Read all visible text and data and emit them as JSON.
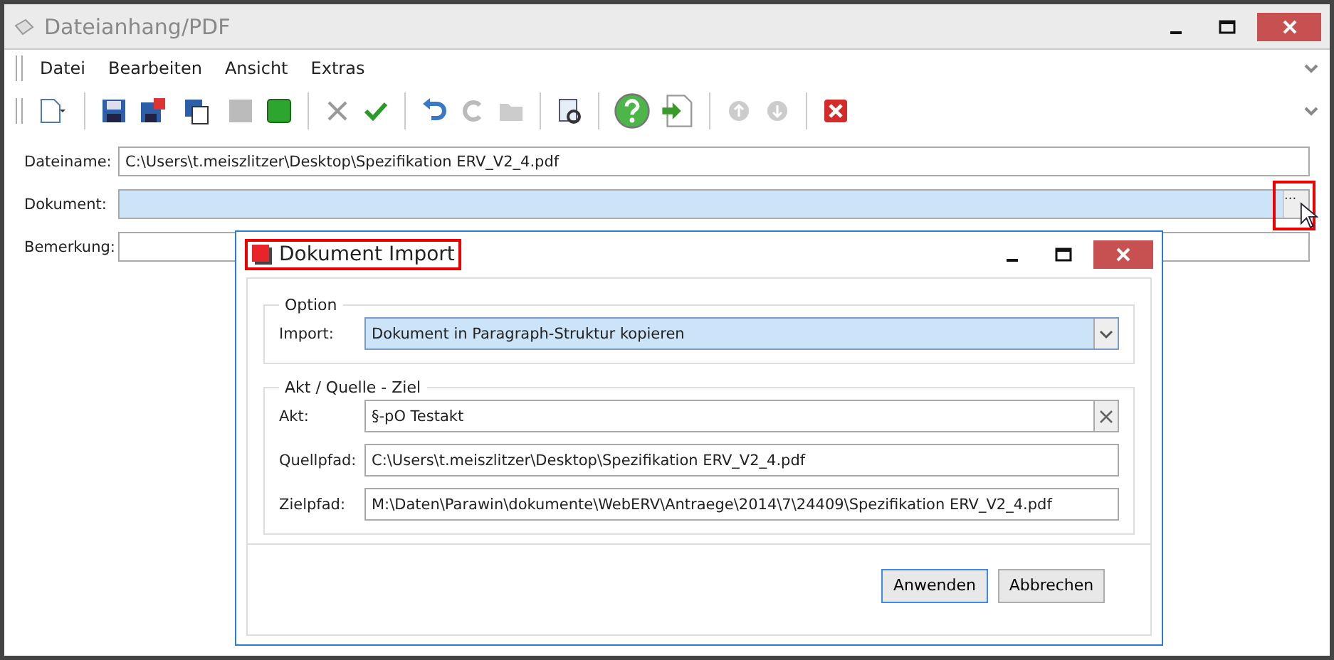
{
  "window": {
    "title": "Dateianhang/PDF"
  },
  "menu": [
    {
      "label": "Datei"
    },
    {
      "label": "Bearbeiten"
    },
    {
      "label": "Ansicht"
    },
    {
      "label": "Extras"
    }
  ],
  "form": [
    {
      "label": "Dateiname:",
      "value": "C:\\Users\\t.meiszlitzer\\Desktop\\Spezifikation ERV_V2_4.pdf",
      "selected": false
    },
    {
      "label": "Dokument:",
      "selected": true,
      "browse": "...",
      "highlighted": true
    },
    {
      "label": "Bemerkung:",
      "selected": false
    }
  ],
  "dialog": {
    "title": "Dokument Import",
    "highlighted": true,
    "groups": [
      {
        "title": "Option",
        "fields": [
          {
            "kind": "select",
            "label": "Import:",
            "value": "Dokument in Paragraph-Struktur kopieren",
            "selected": true
          }
        ]
      },
      {
        "title": "Akt / Quelle - Ziel",
        "fields": [
          {
            "kind": "clearable",
            "label": "Akt:",
            "value": "§-pO Testakt",
            "selected": false
          },
          {
            "kind": "text",
            "label": "Quellpfad:",
            "value": "C:\\Users\\t.meiszlitzer\\Desktop\\Spezifikation ERV_V2_4.pdf",
            "selected": false
          },
          {
            "kind": "text",
            "label": "Zielpfad:",
            "value": "M:\\Daten\\Parawin\\dokumente\\WebERV\\Antraege\\2014\\7\\24409\\Spezifikation ERV_V2_4.pdf",
            "selected": false
          }
        ]
      }
    ],
    "buttons": [
      {
        "label": "Anwenden",
        "selected": true
      },
      {
        "label": "Abbrechen",
        "selected": false
      }
    ]
  }
}
